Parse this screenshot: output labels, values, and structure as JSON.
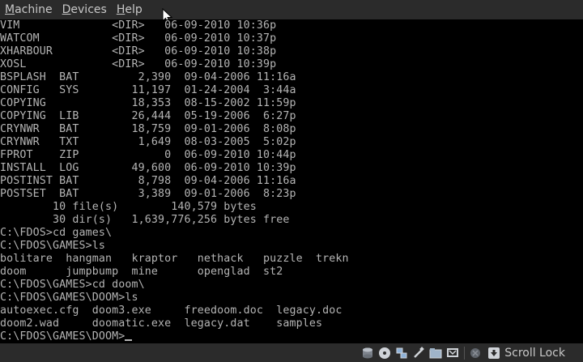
{
  "menubar": {
    "items": [
      {
        "label": "Machine",
        "accel": "M",
        "rest": "achine"
      },
      {
        "label": "Devices",
        "accel": "D",
        "rest": "evices"
      },
      {
        "label": "Help",
        "accel": "H",
        "rest": "elp"
      }
    ]
  },
  "terminal": {
    "lines": [
      "VIM              <DIR>   06-09-2010 10:36p",
      "WATCOM           <DIR>   06-09-2010 10:37p",
      "XHARBOUR         <DIR>   06-09-2010 10:38p",
      "XOSL             <DIR>   06-09-2010 10:39p",
      "BSPLASH  BAT         2,390  09-04-2006 11:16a",
      "CONFIG   SYS        11,197  01-24-2004  3:44a",
      "COPYING             18,353  08-15-2002 11:59p",
      "COPYING  LIB        26,444  05-19-2006  6:27p",
      "CRYNWR   BAT        18,759  09-01-2006  8:08p",
      "CRYNWR   TXT         1,649  08-03-2005  5:02p",
      "FPROT    ZIP             0  06-09-2010 10:44p",
      "INSTALL  LOG        49,600  06-09-2010 10:39p",
      "POSTINST BAT         8,798  09-04-2006 11:16a",
      "POSTSET  BAT         3,389  09-01-2006  8:23p",
      "        10 file(s)        140,579 bytes",
      "        30 dir(s)   1,639,776,256 bytes free",
      "C:\\FDOS>cd games\\",
      "C:\\FDOS\\GAMES>ls",
      "bolitare  hangman   kraptor   nethack   puzzle  trekn",
      "doom      jumpbump  mine      openglad  st2",
      "C:\\FDOS\\GAMES>cd doom\\",
      "C:\\FDOS\\GAMES\\DOOM>ls",
      "autoexec.cfg  doom3.exe     freedoom.doc  legacy.doc",
      "doom2.wad     doomatic.exe  legacy.dat    samples",
      "C:\\FDOS\\GAMES\\DOOM>"
    ]
  },
  "statusbar": {
    "icons": [
      "hard-disk-icon",
      "optical-disc-icon",
      "network-icon",
      "usb-icon",
      "shared-folder-icon",
      "display-icon",
      "capture-icon",
      "mouse-integration-icon"
    ],
    "scroll_lock_label": "Scroll Lock"
  },
  "colors": {
    "terminal_bg": "#000000",
    "terminal_fg": "#b4b4b4",
    "chrome_bg": "#2b2b2b",
    "chrome_fg": "#c8c8c8"
  }
}
